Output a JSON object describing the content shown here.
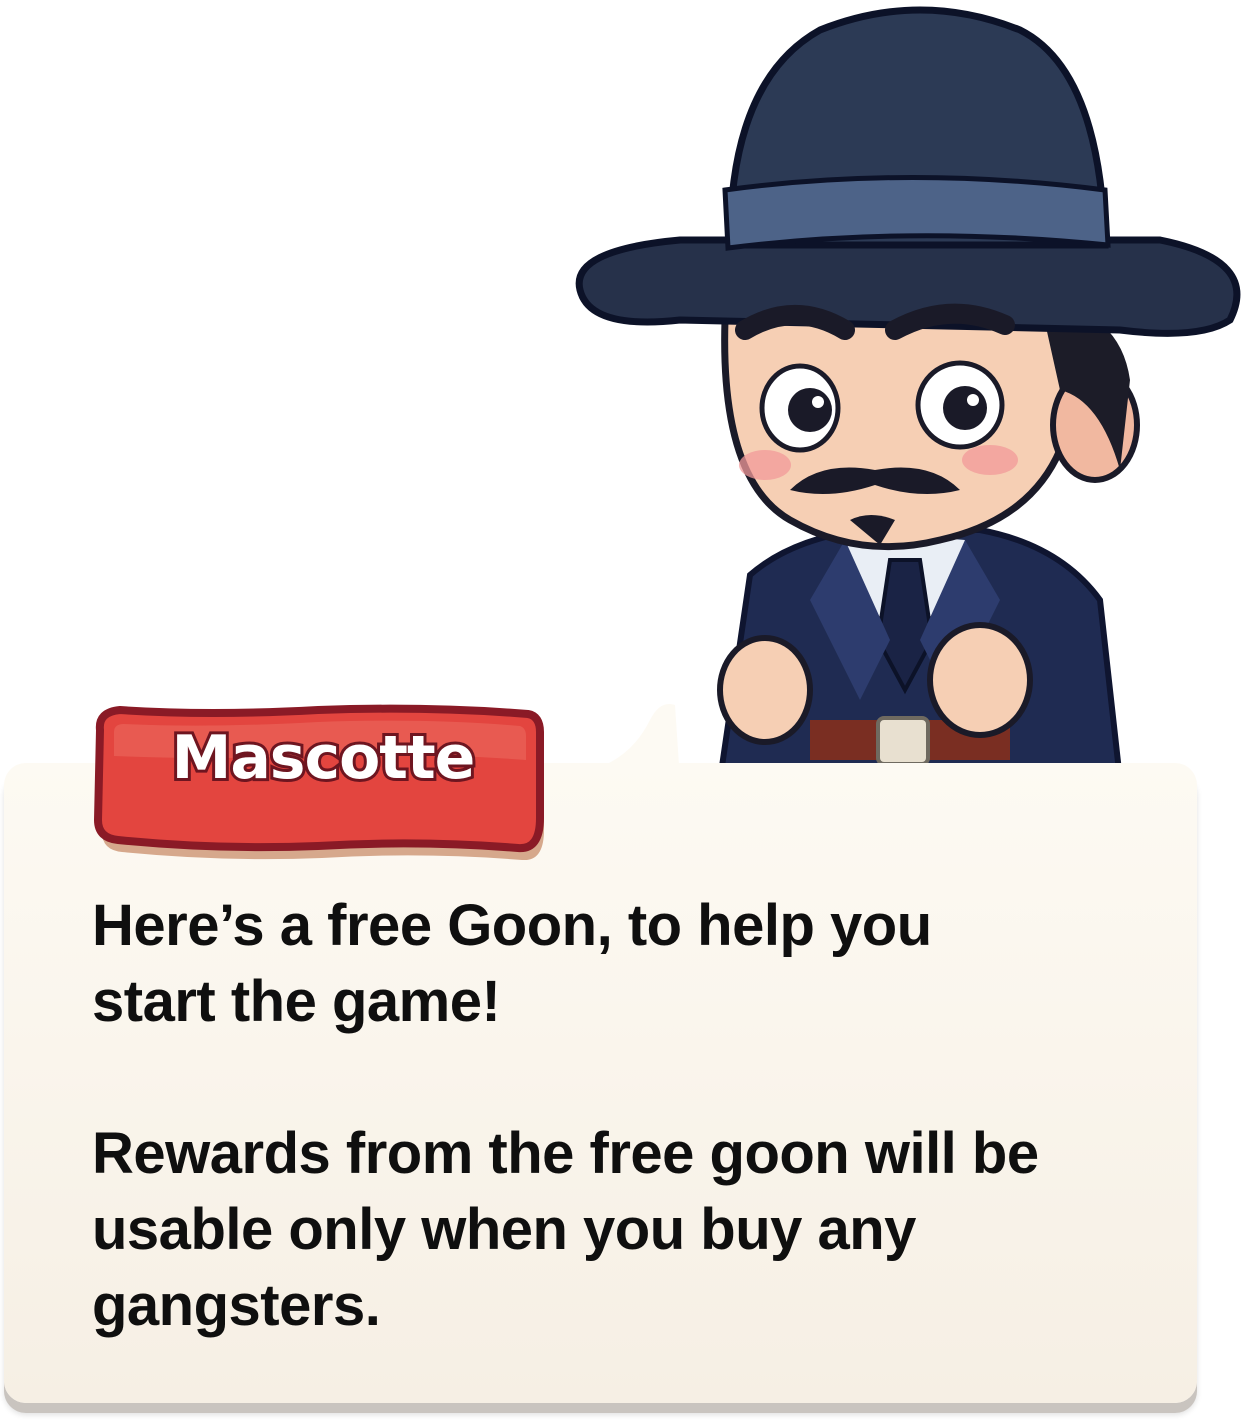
{
  "dialog": {
    "speaker_name": "Mascotte",
    "message_1": "Here’s a free Goon, to help you\nstart the game!",
    "message_2": "Rewards from the free goon will be\nusable only when you buy any\ngangsters."
  },
  "character": {
    "icon": "gangster-mascot-icon",
    "description_colors": {
      "hat": "#2c3a55",
      "suit": "#1f2b52",
      "skin": "#f6cfb4",
      "hair": "#1c1c28"
    }
  },
  "colors": {
    "banner_fill": "#e3453f",
    "banner_outline": "#8a1a26",
    "card_background": "#fbf6ee",
    "text": "#0f0f0f"
  }
}
